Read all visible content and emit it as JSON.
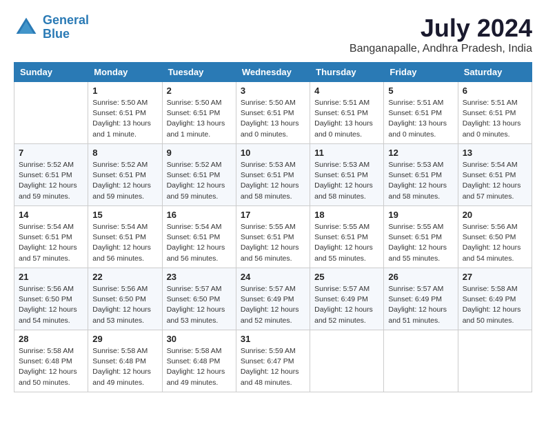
{
  "header": {
    "logo_line1": "General",
    "logo_line2": "Blue",
    "month": "July 2024",
    "location": "Banganapalle, Andhra Pradesh, India"
  },
  "days_of_week": [
    "Sunday",
    "Monday",
    "Tuesday",
    "Wednesday",
    "Thursday",
    "Friday",
    "Saturday"
  ],
  "weeks": [
    [
      {
        "day": "",
        "info": ""
      },
      {
        "day": "1",
        "info": "Sunrise: 5:50 AM\nSunset: 6:51 PM\nDaylight: 13 hours\nand 1 minute."
      },
      {
        "day": "2",
        "info": "Sunrise: 5:50 AM\nSunset: 6:51 PM\nDaylight: 13 hours\nand 1 minute."
      },
      {
        "day": "3",
        "info": "Sunrise: 5:50 AM\nSunset: 6:51 PM\nDaylight: 13 hours\nand 0 minutes."
      },
      {
        "day": "4",
        "info": "Sunrise: 5:51 AM\nSunset: 6:51 PM\nDaylight: 13 hours\nand 0 minutes."
      },
      {
        "day": "5",
        "info": "Sunrise: 5:51 AM\nSunset: 6:51 PM\nDaylight: 13 hours\nand 0 minutes."
      },
      {
        "day": "6",
        "info": "Sunrise: 5:51 AM\nSunset: 6:51 PM\nDaylight: 13 hours\nand 0 minutes."
      }
    ],
    [
      {
        "day": "7",
        "info": "Sunrise: 5:52 AM\nSunset: 6:51 PM\nDaylight: 12 hours\nand 59 minutes."
      },
      {
        "day": "8",
        "info": "Sunrise: 5:52 AM\nSunset: 6:51 PM\nDaylight: 12 hours\nand 59 minutes."
      },
      {
        "day": "9",
        "info": "Sunrise: 5:52 AM\nSunset: 6:51 PM\nDaylight: 12 hours\nand 59 minutes."
      },
      {
        "day": "10",
        "info": "Sunrise: 5:53 AM\nSunset: 6:51 PM\nDaylight: 12 hours\nand 58 minutes."
      },
      {
        "day": "11",
        "info": "Sunrise: 5:53 AM\nSunset: 6:51 PM\nDaylight: 12 hours\nand 58 minutes."
      },
      {
        "day": "12",
        "info": "Sunrise: 5:53 AM\nSunset: 6:51 PM\nDaylight: 12 hours\nand 58 minutes."
      },
      {
        "day": "13",
        "info": "Sunrise: 5:54 AM\nSunset: 6:51 PM\nDaylight: 12 hours\nand 57 minutes."
      }
    ],
    [
      {
        "day": "14",
        "info": "Sunrise: 5:54 AM\nSunset: 6:51 PM\nDaylight: 12 hours\nand 57 minutes."
      },
      {
        "day": "15",
        "info": "Sunrise: 5:54 AM\nSunset: 6:51 PM\nDaylight: 12 hours\nand 56 minutes."
      },
      {
        "day": "16",
        "info": "Sunrise: 5:54 AM\nSunset: 6:51 PM\nDaylight: 12 hours\nand 56 minutes."
      },
      {
        "day": "17",
        "info": "Sunrise: 5:55 AM\nSunset: 6:51 PM\nDaylight: 12 hours\nand 56 minutes."
      },
      {
        "day": "18",
        "info": "Sunrise: 5:55 AM\nSunset: 6:51 PM\nDaylight: 12 hours\nand 55 minutes."
      },
      {
        "day": "19",
        "info": "Sunrise: 5:55 AM\nSunset: 6:51 PM\nDaylight: 12 hours\nand 55 minutes."
      },
      {
        "day": "20",
        "info": "Sunrise: 5:56 AM\nSunset: 6:50 PM\nDaylight: 12 hours\nand 54 minutes."
      }
    ],
    [
      {
        "day": "21",
        "info": "Sunrise: 5:56 AM\nSunset: 6:50 PM\nDaylight: 12 hours\nand 54 minutes."
      },
      {
        "day": "22",
        "info": "Sunrise: 5:56 AM\nSunset: 6:50 PM\nDaylight: 12 hours\nand 53 minutes."
      },
      {
        "day": "23",
        "info": "Sunrise: 5:57 AM\nSunset: 6:50 PM\nDaylight: 12 hours\nand 53 minutes."
      },
      {
        "day": "24",
        "info": "Sunrise: 5:57 AM\nSunset: 6:49 PM\nDaylight: 12 hours\nand 52 minutes."
      },
      {
        "day": "25",
        "info": "Sunrise: 5:57 AM\nSunset: 6:49 PM\nDaylight: 12 hours\nand 52 minutes."
      },
      {
        "day": "26",
        "info": "Sunrise: 5:57 AM\nSunset: 6:49 PM\nDaylight: 12 hours\nand 51 minutes."
      },
      {
        "day": "27",
        "info": "Sunrise: 5:58 AM\nSunset: 6:49 PM\nDaylight: 12 hours\nand 50 minutes."
      }
    ],
    [
      {
        "day": "28",
        "info": "Sunrise: 5:58 AM\nSunset: 6:48 PM\nDaylight: 12 hours\nand 50 minutes."
      },
      {
        "day": "29",
        "info": "Sunrise: 5:58 AM\nSunset: 6:48 PM\nDaylight: 12 hours\nand 49 minutes."
      },
      {
        "day": "30",
        "info": "Sunrise: 5:58 AM\nSunset: 6:48 PM\nDaylight: 12 hours\nand 49 minutes."
      },
      {
        "day": "31",
        "info": "Sunrise: 5:59 AM\nSunset: 6:47 PM\nDaylight: 12 hours\nand 48 minutes."
      },
      {
        "day": "",
        "info": ""
      },
      {
        "day": "",
        "info": ""
      },
      {
        "day": "",
        "info": ""
      }
    ]
  ]
}
